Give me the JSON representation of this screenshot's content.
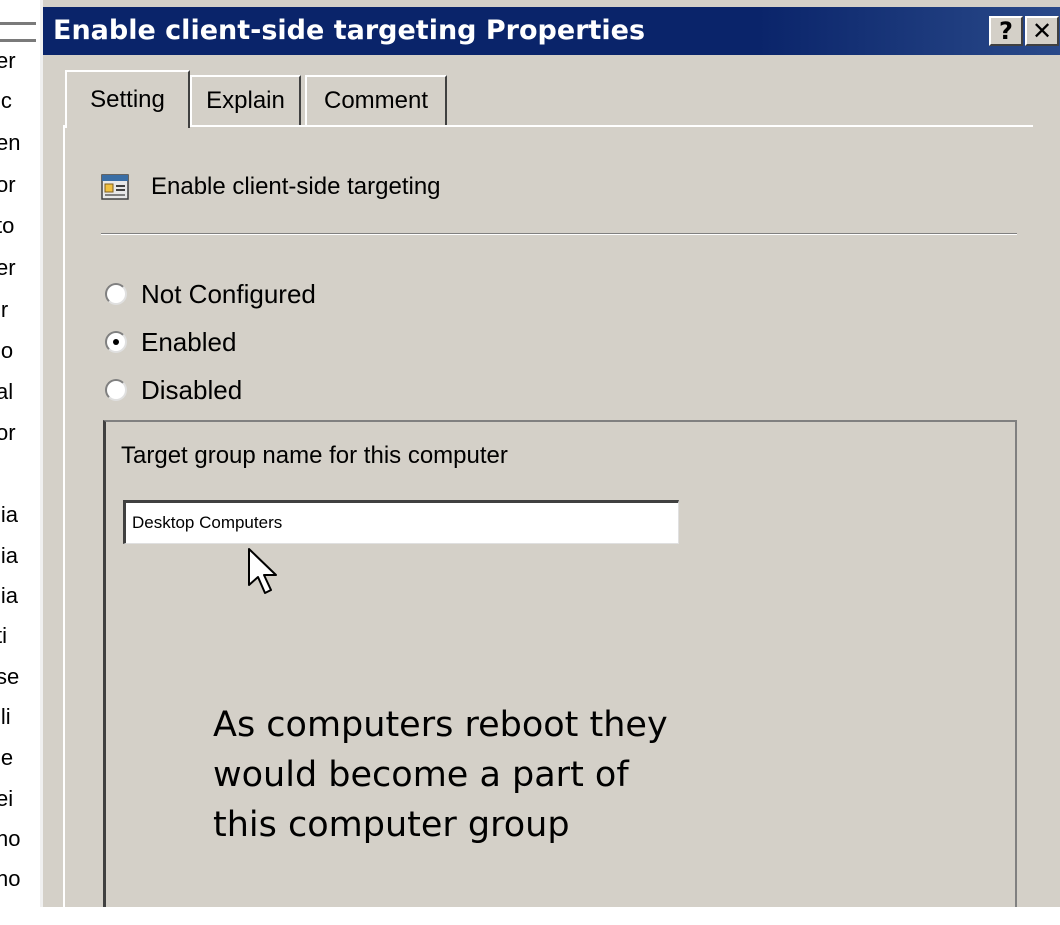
{
  "background": {
    "fragments": [
      "er",
      "ic",
      "en",
      "or",
      "to",
      "er",
      "ir",
      "lo",
      "al",
      "or",
      "",
      "lia",
      "lia",
      "lia",
      "ti",
      "se",
      "ili",
      "ie",
      "ei",
      "no",
      "no"
    ]
  },
  "dialog": {
    "title": "Enable client-side targeting Properties",
    "help_button": "?",
    "close_button": "✕"
  },
  "tabs": [
    {
      "label": "Setting",
      "active": true
    },
    {
      "label": "Explain",
      "active": false
    },
    {
      "label": "Comment",
      "active": false
    }
  ],
  "policy": {
    "icon": "policy-settings-icon",
    "name": "Enable client-side targeting"
  },
  "radios": {
    "not_configured": "Not Configured",
    "enabled": "Enabled",
    "disabled": "Disabled",
    "selected": "enabled"
  },
  "options": {
    "field_label": "Target group name for this computer",
    "field_value": "Desktop Computers"
  },
  "annotation": {
    "line1": "As computers reboot they",
    "line2": "would become a part of",
    "line3": "this computer group"
  },
  "colors": {
    "titlebar": "#0a246a",
    "dialog_face": "#d4d0c8"
  }
}
